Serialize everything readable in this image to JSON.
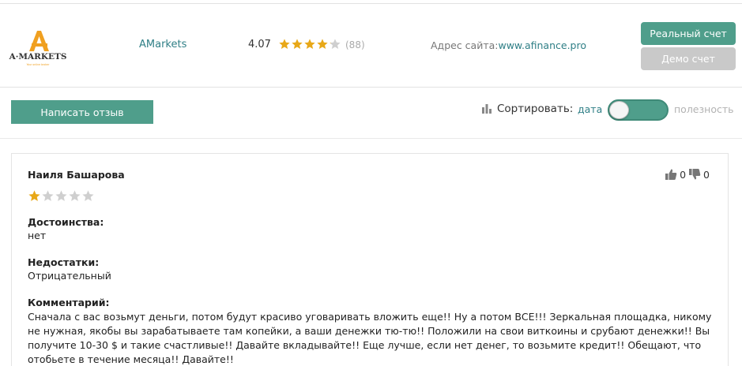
{
  "broker": {
    "logo_text": "A·MARKETS",
    "logo_tagline": "Your online broker",
    "name": "AMarkets",
    "rating": "4.07",
    "rating_value": 4.07,
    "rating_max": 5,
    "reviews_count": "(88)",
    "site_label": "Адрес сайта:",
    "site_url": "www.afinance.pro",
    "real_account_label": "Реальный счет",
    "demo_account_label": "Демо счет"
  },
  "toolbar": {
    "write_review_label": "Написать отзыв",
    "sort_label": "Сортировать:",
    "sort_date": "дата",
    "sort_usefulness": "полезность",
    "toggle_state": "date"
  },
  "review": {
    "author": "Наиля Башарова",
    "stars": 1,
    "stars_max": 5,
    "likes": "0",
    "dislikes": "0",
    "pros_title": "Достоинства:",
    "pros_text": "нет",
    "cons_title": "Недостатки:",
    "cons_text": "Отрицательный",
    "comment_title": "Комментарий:",
    "comment_text": "Сначала с вас возьмут деньги, потом будут красиво уговаривать вложить еще!! Ну а потом ВСЕ!!! Зеркальная площадка, никому не нужная, якобы вы зарабатываете там копейки, а ваши денежки тю-тю!! Положили на свои виткоины и срубают денежки!! Вы получите 10-30 $ и такие счастливые!! Давайте вкладывайте!! Еще лучше, если нет денег, то возьмите кредит!! Обещают, что отобьете в течение месяца!! Давайте!!"
  },
  "colors": {
    "accent": "#4f9e8b",
    "link": "#2f7f86",
    "star_gold": "#e8a818",
    "star_empty": "#cfcfcf",
    "demo_button": "#c9c9c9",
    "logo_orange": "#f0a020"
  }
}
